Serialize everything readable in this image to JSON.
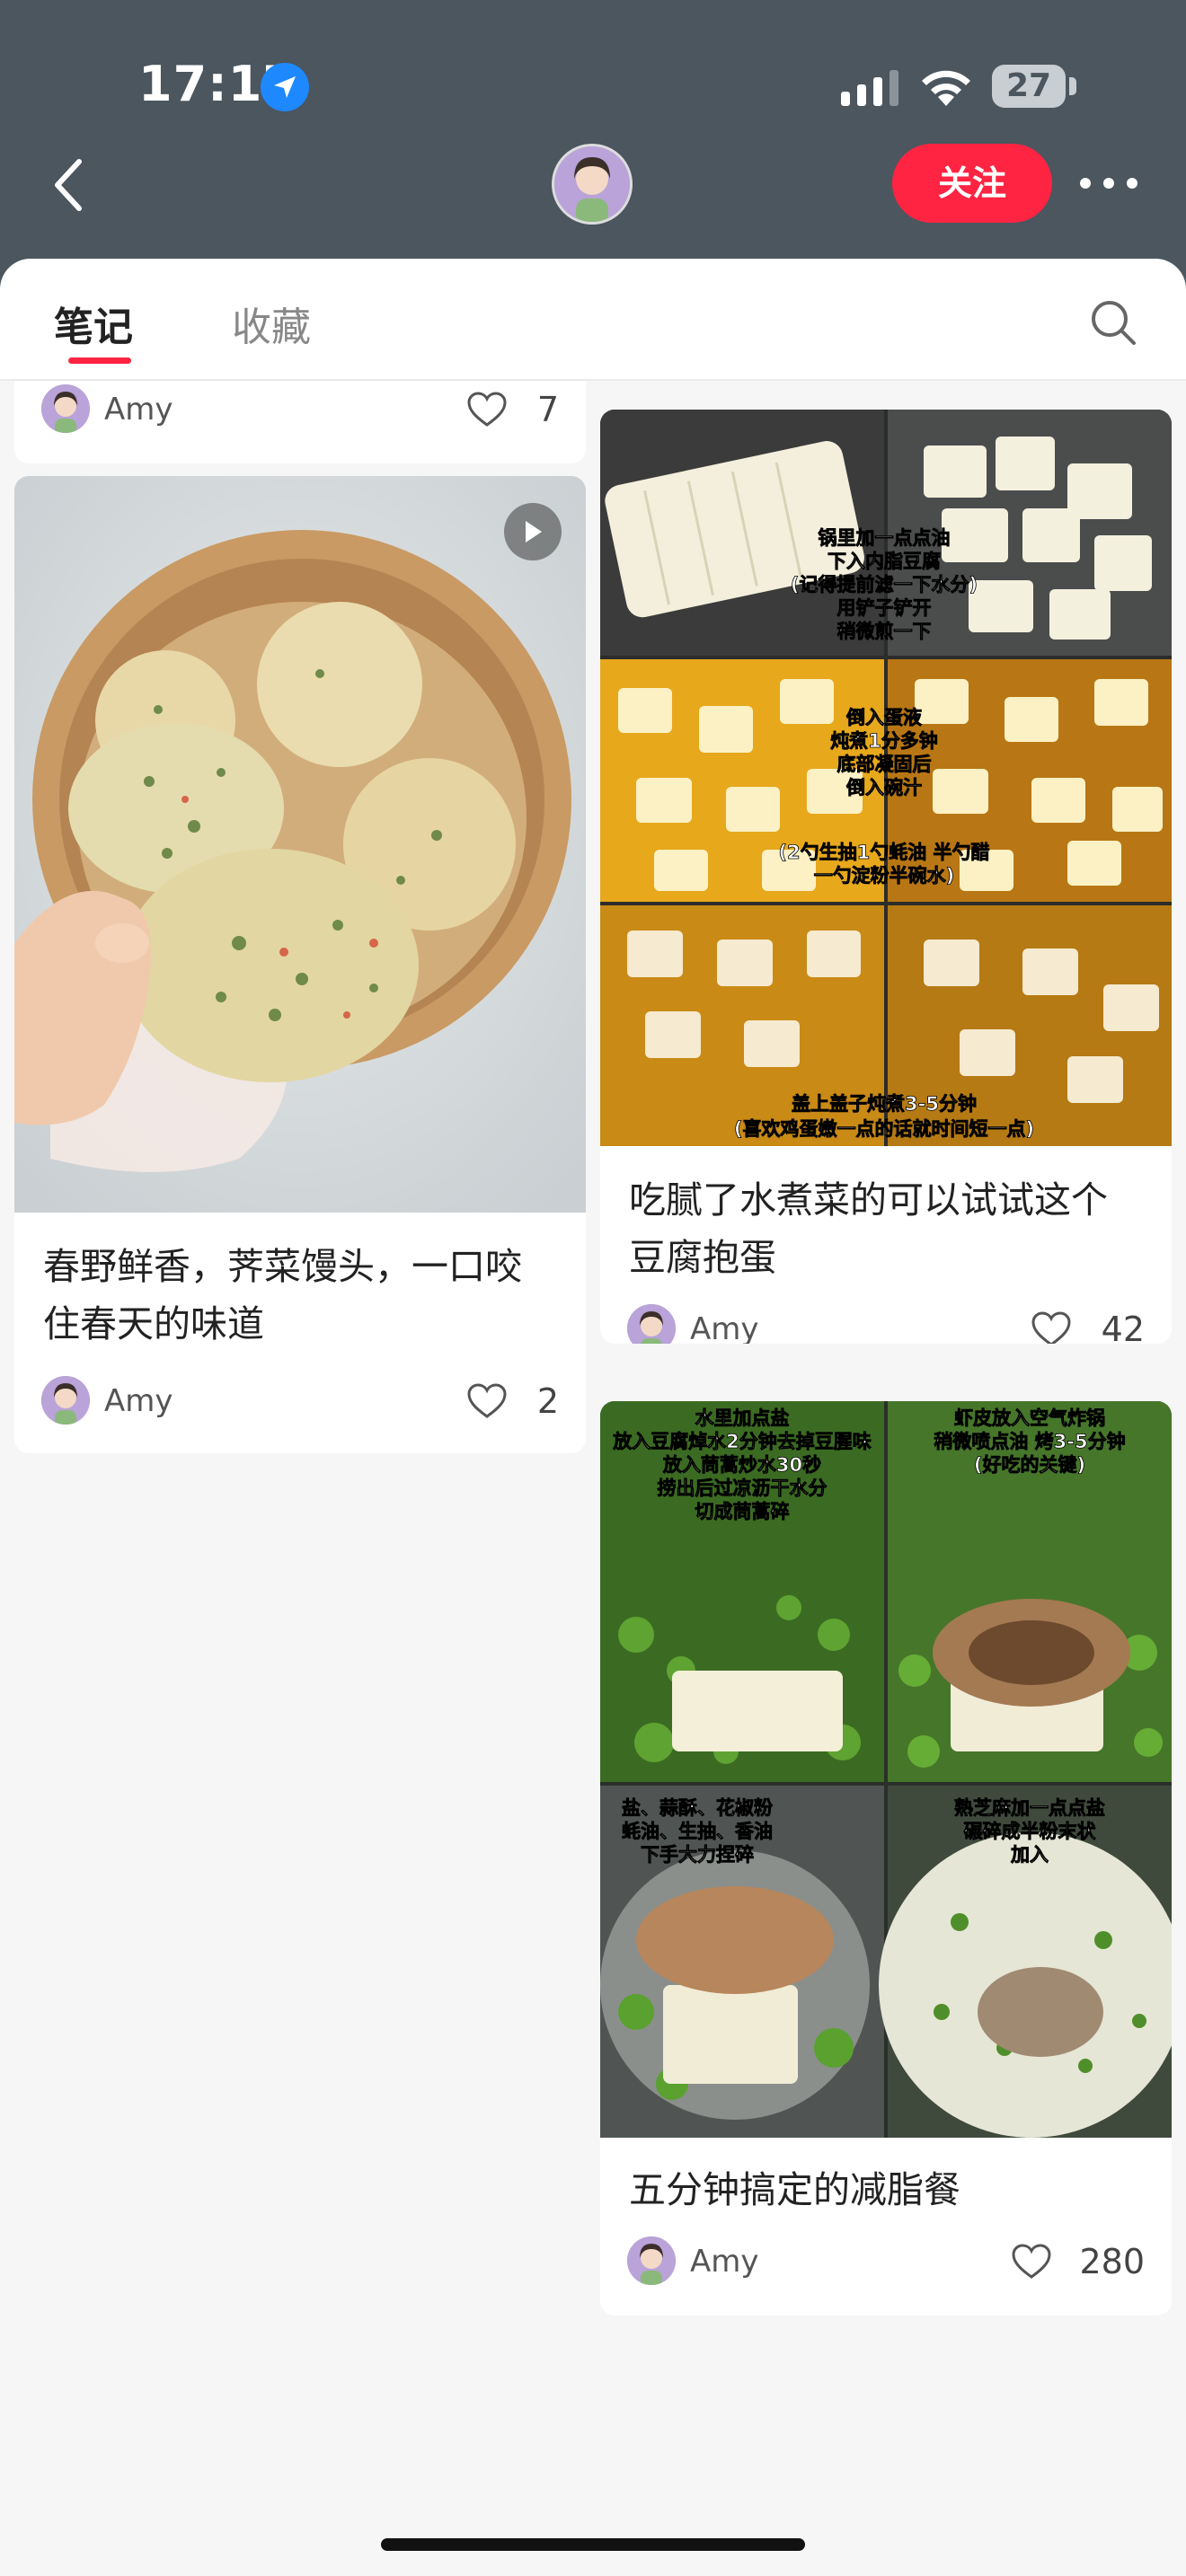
{
  "status": {
    "time": "17:17",
    "battery": "27"
  },
  "header": {
    "follow_label": "关注"
  },
  "tabs": {
    "notes": "笔记",
    "favorites": "收藏"
  },
  "feed": {
    "top_partial": {
      "author": "Amy",
      "likes": "7"
    },
    "left_card": {
      "title_line1": "春野鲜香，荠菜馒头，一口咬",
      "title_line2": "住春天的味道",
      "author": "Amy",
      "likes": "2"
    },
    "right_card1": {
      "title_line1": "吃腻了水煮菜的可以试试这个",
      "title_line2": "豆腐抱蛋",
      "author": "Amy",
      "likes": "42",
      "image_text": {
        "step1": [
          "锅里加一点点油",
          "下入内脂豆腐",
          "(记得提前滤一下水分)",
          "用铲子铲开",
          "稍微煎一下"
        ],
        "step2": [
          "倒入蛋液",
          "炖煮1分多钟",
          "底部凝固后",
          "倒入碗汁",
          "(2勺生抽1勺蚝油 半勺醋",
          "一勺淀粉半碗水)"
        ],
        "step3": [
          "盖上盖子炖煮3-5分钟",
          "(喜欢鸡蛋嫩一点的话就时间短一点)"
        ]
      }
    },
    "right_card2": {
      "title": "五分钟搞定的减脂餐",
      "author": "Amy",
      "likes": "280",
      "image_text": {
        "q1": [
          "水里加点盐",
          "放入豆腐焯水2分钟去掉豆腥味",
          "放入茼蒿炒水30秒",
          "捞出后过凉沥干水分",
          "切成茼蒿碎"
        ],
        "q2": [
          "虾皮放入空气炸锅",
          "稍微喷点油 烤3-5分钟",
          "(好吃的关键)"
        ],
        "q3": [
          "盐、蒜酥、花椒粉",
          "蚝油、生抽、香油",
          "下手大力捏碎"
        ],
        "q4": [
          "熟芝麻加一点点盐",
          "碾碎成半粉末状",
          "加入"
        ]
      }
    }
  }
}
